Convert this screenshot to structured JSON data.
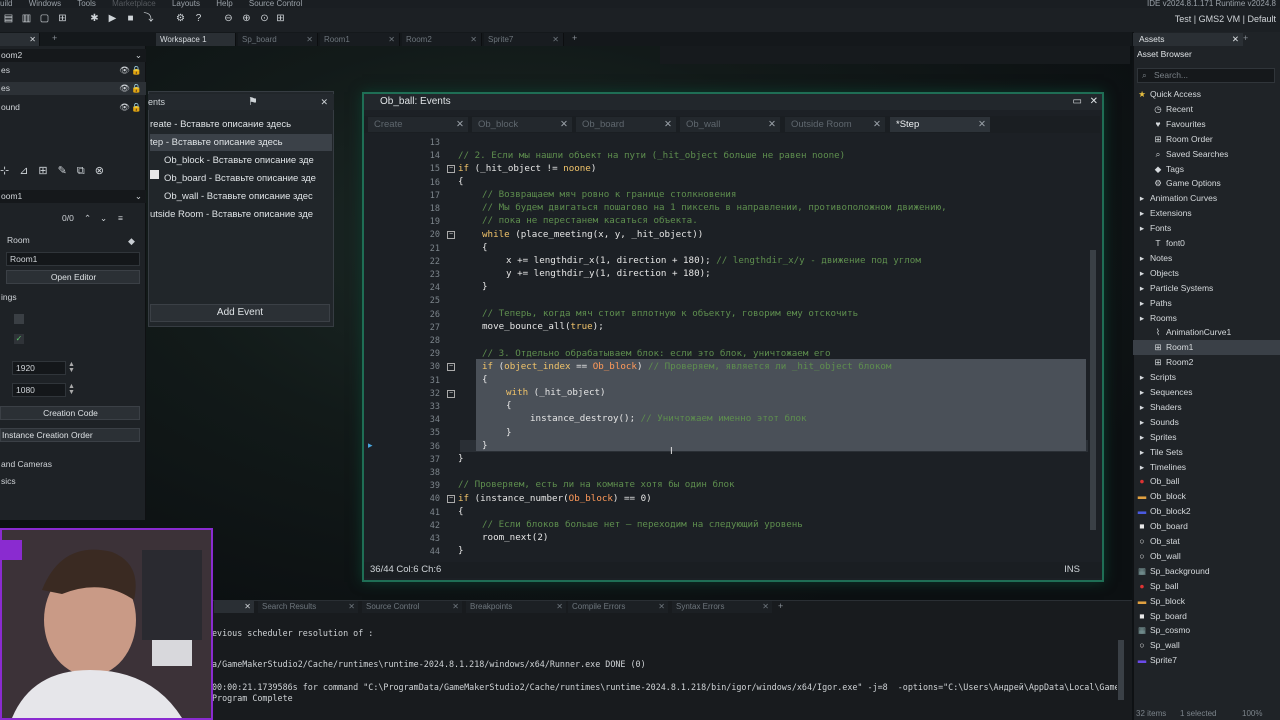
{
  "menubar": {
    "items": [
      "uild",
      "Windows",
      "Tools",
      "Marketplace",
      "Layouts",
      "Help",
      "Source Control"
    ],
    "version": "IDE v2024.8.1.171 Runtime v2024.8"
  },
  "toolbar": {
    "target": "Test | GMS2 VM | Default"
  },
  "workspace_tabs": [
    "Workspace 1",
    "Sp_board",
    "Room1",
    "Room2",
    "Sprite7"
  ],
  "left": {
    "room_select": "oom2",
    "layer1": "es",
    "layer2": "ound",
    "room_dropdown": "oom1",
    "inst_count": "0/0",
    "room_label": "Room",
    "room_name": "Room1",
    "open_editor": "Open Editor",
    "settings": "ings",
    "width": "1920",
    "height": "1080",
    "creation_code": "Creation Code",
    "instance_order": "Instance Creation Order",
    "views": "and Cameras",
    "physics": "sics"
  },
  "events": {
    "title": "ents",
    "rows": [
      "reate - Вставьте описание здесь",
      "tep - Вставьте описание здесь",
      "Ob_block - Вставьте описание зде",
      "Ob_board - Вставьте описание зде",
      "Ob_wall - Вставьте описание здес",
      "utside Room - Вставьте описание зде"
    ],
    "add_event": "Add Event"
  },
  "code_window": {
    "title": "Ob_ball: Events",
    "tabs": [
      "Create",
      "Ob_block",
      "Ob_board",
      "Ob_wall",
      "Outside Room",
      "*Step"
    ],
    "status": "36/44 Col:6 Ch:6",
    "mode": "INS",
    "line_numbers": [
      "13",
      "14",
      "15",
      "16",
      "17",
      "18",
      "19",
      "20",
      "21",
      "22",
      "23",
      "24",
      "25",
      "26",
      "27",
      "28",
      "29",
      "30",
      "31",
      "32",
      "33",
      "34",
      "35",
      "36",
      "37",
      "38",
      "39",
      "40",
      "41",
      "42",
      "43",
      "44"
    ]
  },
  "assets": {
    "title": "Assets",
    "browser": "Asset Browser",
    "search_placeholder": "Search...",
    "rows": [
      {
        "label": "Quick Access",
        "icon": "star-icon",
        "indent": 0
      },
      {
        "label": "Recent",
        "icon": "clock-icon",
        "indent": 1
      },
      {
        "label": "Favourites",
        "icon": "heart-icon",
        "indent": 1
      },
      {
        "label": "Room Order",
        "icon": "grid-icon",
        "indent": 1
      },
      {
        "label": "Saved Searches",
        "icon": "search-icon",
        "indent": 1
      },
      {
        "label": "Tags",
        "icon": "tag-icon",
        "indent": 1
      },
      {
        "label": "Game Options",
        "icon": "gear-icon",
        "indent": 1
      },
      {
        "label": "Animation Curves",
        "icon": "folder-icon",
        "indent": 0
      },
      {
        "label": "Extensions",
        "icon": "folder-icon",
        "indent": 0
      },
      {
        "label": "Fonts",
        "icon": "folder-icon",
        "indent": 0
      },
      {
        "label": "font0",
        "icon": "font-icon",
        "indent": 1
      },
      {
        "label": "Notes",
        "icon": "folder-icon",
        "indent": 0
      },
      {
        "label": "Objects",
        "icon": "folder-icon",
        "indent": 0
      },
      {
        "label": "Particle Systems",
        "icon": "folder-icon",
        "indent": 0
      },
      {
        "label": "Paths",
        "icon": "folder-icon",
        "indent": 0
      },
      {
        "label": "Rooms",
        "icon": "folder-icon",
        "indent": 0
      },
      {
        "label": "AnimationCurve1",
        "icon": "curve-icon",
        "indent": 1
      },
      {
        "label": "Room1",
        "icon": "room-icon",
        "indent": 1
      },
      {
        "label": "Room2",
        "icon": "room-icon",
        "indent": 1
      },
      {
        "label": "Scripts",
        "icon": "folder-icon",
        "indent": 0
      },
      {
        "label": "Sequences",
        "icon": "folder-icon",
        "indent": 0
      },
      {
        "label": "Shaders",
        "icon": "folder-icon",
        "indent": 0
      },
      {
        "label": "Sounds",
        "icon": "folder-icon",
        "indent": 0
      },
      {
        "label": "Sprites",
        "icon": "folder-icon",
        "indent": 0
      },
      {
        "label": "Tile Sets",
        "icon": "folder-icon",
        "indent": 0
      },
      {
        "label": "Timelines",
        "icon": "folder-icon",
        "indent": 0
      },
      {
        "label": "Ob_ball",
        "icon": "ball-icon",
        "indent": 0
      },
      {
        "label": "Ob_block",
        "icon": "block-icon",
        "indent": 0
      },
      {
        "label": "Ob_block2",
        "icon": "block2-icon",
        "indent": 0
      },
      {
        "label": "Ob_board",
        "icon": "board-icon",
        "indent": 0
      },
      {
        "label": "Ob_stat",
        "icon": "stat-icon",
        "indent": 0
      },
      {
        "label": "Ob_wall",
        "icon": "wall-icon",
        "indent": 0
      },
      {
        "label": "Sp_background",
        "icon": "sprite-icon",
        "indent": 0
      },
      {
        "label": "Sp_ball",
        "icon": "ball-icon",
        "indent": 0
      },
      {
        "label": "Sp_block",
        "icon": "block-icon",
        "indent": 0
      },
      {
        "label": "Sp_board",
        "icon": "board-icon",
        "indent": 0
      },
      {
        "label": "Sp_cosmo",
        "icon": "sprite-icon",
        "indent": 0
      },
      {
        "label": "Sp_wall",
        "icon": "wall-icon",
        "indent": 0
      },
      {
        "label": "Sprite7",
        "icon": "sprite7-icon",
        "indent": 0
      }
    ],
    "footer_items": "32 items",
    "footer_selected": "1 selected",
    "footer_zoom": "100%"
  },
  "bottom": {
    "tabs": [
      "Search Results",
      "Source Control",
      "Breakpoints",
      "Compile Errors",
      "Syntax Errors"
    ],
    "lines": [
      "evious scheduler resolution of :",
      "",
      "a/GameMakerStudio2/Cache/runtimes\\runtime-2024.8.1.218/windows/x64/Runner.exe DONE (0)",
      "",
      "00:00:21.1739586s for command \"C:\\ProgramData/GameMakerStudio2/Cache/runtimes\\runtime-2024.8.1.218/bin/igor/windows/x64/Igor.exe\" -j=8  -options=\"C:\\Users\\Андрей\\AppData\\Local\\GameM",
      "Program Complete"
    ]
  },
  "colors": {
    "accent": "#1f6e55",
    "comment": "#5e8e4e",
    "keyword": "#f0c36a",
    "webcam_border": "#8a2bd0"
  }
}
